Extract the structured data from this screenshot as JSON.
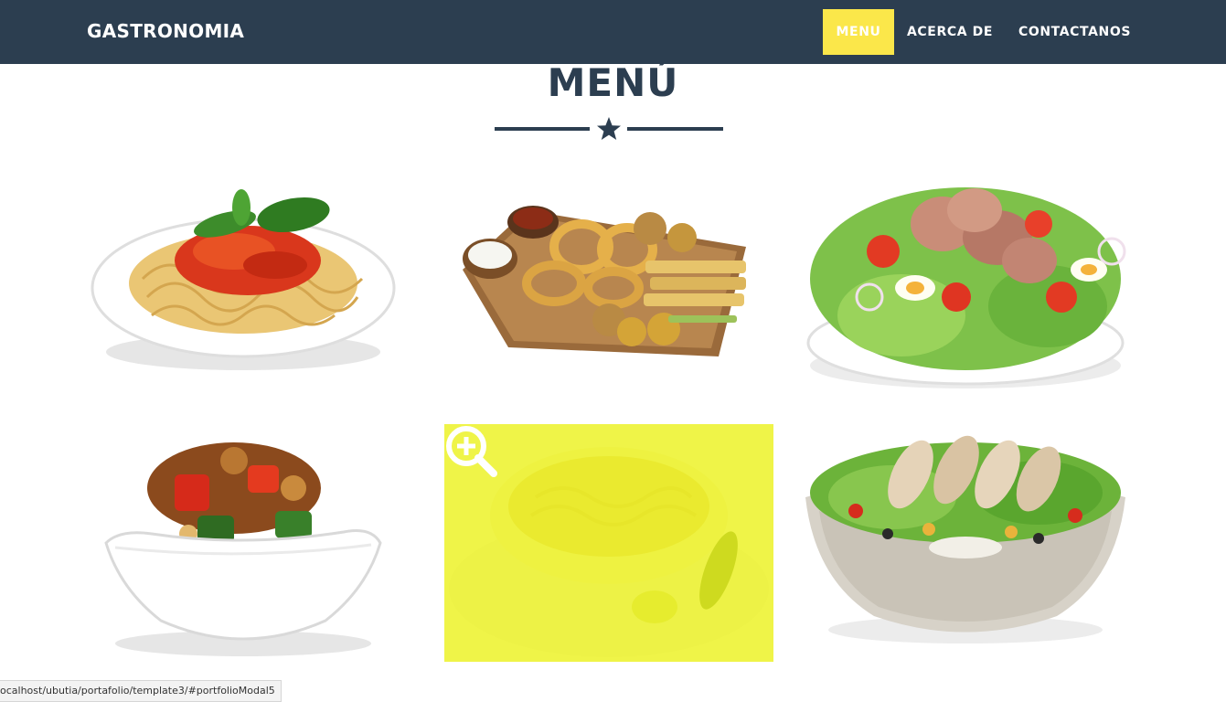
{
  "navbar": {
    "brand": "GASTRONOMIA",
    "items": [
      {
        "label": "MENU",
        "active": true
      },
      {
        "label": "ACERCA DE",
        "active": false
      },
      {
        "label": "CONTACTANOS",
        "active": false
      }
    ],
    "background": "#2c3e50",
    "active_color": "#fbe74a"
  },
  "section": {
    "title": "MENÚ",
    "divider_icon": "star-icon"
  },
  "portfolio": {
    "items": [
      {
        "dish": "spaghetti-plate"
      },
      {
        "dish": "fried-platter"
      },
      {
        "dish": "tuna-egg-salad"
      },
      {
        "dish": "stir-fry-bowl"
      },
      {
        "dish": "soup-bowl",
        "hovered": true,
        "overlay_icon": "zoom-in-icon"
      },
      {
        "dish": "chicken-salad-bowl"
      }
    ],
    "overlay_color": "#eef240"
  },
  "status_bar": {
    "url": "ocalhost/ubutia/portafolio/template3/#portfolioModal5"
  }
}
